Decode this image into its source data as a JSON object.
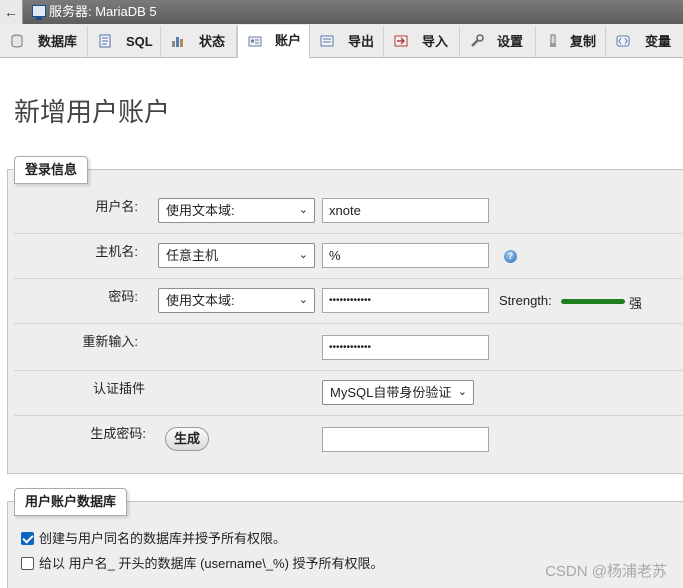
{
  "window": {
    "title": "服务器: MariaDB 5",
    "back_glyph": "←"
  },
  "tabs": [
    {
      "label": "数据库",
      "icon": "database-icon"
    },
    {
      "label": "SQL",
      "icon": "sql-icon"
    },
    {
      "label": "状态",
      "icon": "status-icon"
    },
    {
      "label": "账户",
      "icon": "accounts-icon",
      "active": true
    },
    {
      "label": "导出",
      "icon": "export-icon"
    },
    {
      "label": "导入",
      "icon": "import-icon"
    },
    {
      "label": "设置",
      "icon": "settings-icon"
    },
    {
      "label": "复制",
      "icon": "replication-icon"
    },
    {
      "label": "变量",
      "icon": "variables-icon"
    }
  ],
  "page_title": "新增用户账户",
  "login_section": {
    "legend": "登录信息",
    "username": {
      "label": "用户名:",
      "select": "使用文本域:",
      "value": "xnote"
    },
    "host": {
      "label": "主机名:",
      "select": "任意主机",
      "value": "%"
    },
    "password": {
      "label": "密码:",
      "select": "使用文本域:",
      "value": "••••••••••••",
      "strength_label": "Strength:",
      "strength_text": "强",
      "strength_color": "#1d7f1d"
    },
    "retype": {
      "label": "重新输入:",
      "value": "••••••••••••"
    },
    "auth_plugin": {
      "label": "认证插件",
      "select": "MySQL自带身份验证"
    },
    "generate": {
      "label": "生成密码:",
      "button": "生成",
      "value": ""
    }
  },
  "db_section": {
    "legend": "用户账户数据库",
    "options": [
      {
        "label": "创建与用户同名的数据库并授予所有权限。",
        "checked": true
      },
      {
        "label": "给以 用户名_ 开头的数据库 (username\\_%) 授予所有权限。",
        "checked": false
      }
    ]
  },
  "watermark": "CSDN @杨浦老苏",
  "colors": {
    "accent_checkbox": "#0a66c2",
    "help_icon": "#2c6fb6"
  }
}
